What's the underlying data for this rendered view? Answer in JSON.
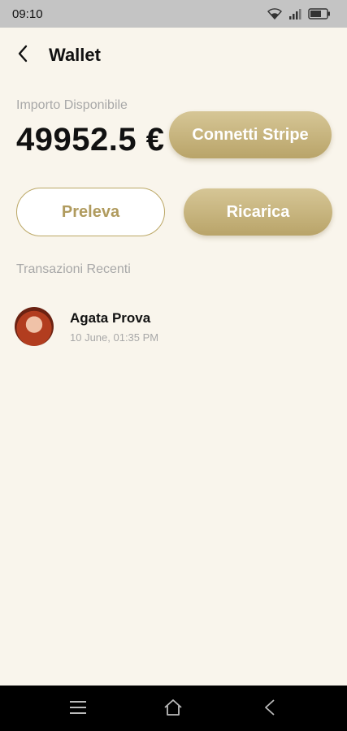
{
  "status_bar": {
    "time": "09:10",
    "icons": [
      "wifi-icon",
      "signal-icon",
      "battery-icon"
    ]
  },
  "header": {
    "back_icon": "chevron-left-icon",
    "title": "Wallet"
  },
  "balance": {
    "label": "Importo Disponibile",
    "amount": "49952.5 €"
  },
  "buttons": {
    "connect_stripe": "Connetti Stripe",
    "withdraw": "Preleva",
    "top_up": "Ricarica"
  },
  "transactions": {
    "title": "Transazioni Recenti",
    "items": [
      {
        "name": "Agata Prova",
        "date": "10 June, 01:35 PM"
      }
    ]
  },
  "nav_bar": {
    "icons": [
      "menu-icon",
      "home-icon",
      "back-icon"
    ]
  },
  "colors": {
    "background": "#f9f5ec",
    "accent_gold": "#c4b07a",
    "status_bar": "#c4c4c4",
    "nav_bar": "#000000"
  }
}
